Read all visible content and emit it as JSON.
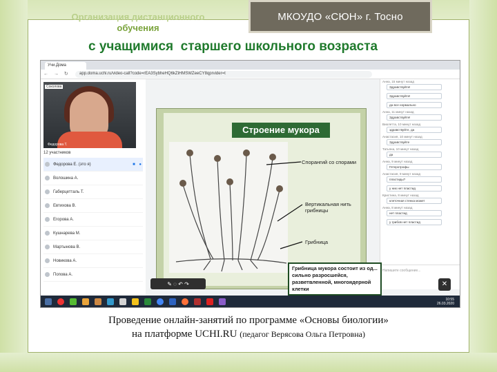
{
  "slide": {
    "org_title_line1": "Организация дистанционного",
    "org_title_line2": "обучения",
    "badge": "МКОУДО «СЮН»  г. Тосно",
    "subtitle": "с учащимися  старшего школьного возраста",
    "caption_line1": "Проведение онлайн-занятий по программе «Основы биологии»",
    "caption_line2": "на платформе UCHI.RU",
    "caption_note": "(педагог Верясова Ольга Петровна)"
  },
  "browser": {
    "tab_label": "Учи.Дома",
    "url": "app.doma.uchi.ru/video-call?code=rEA3SybheHQ6kZiHMSWZeeCY8qprvider=t",
    "nav_icons": "← → ↻"
  },
  "meeting": {
    "video_name": "Федорова Т.",
    "camera_tag": "Соколова",
    "participants_count": "12 участников",
    "participants": [
      "Федорова Е. (это я)",
      "Волошина А.",
      "Габерцетталь Т.",
      "Евтихова В.",
      "Егорова А.",
      "Кушнарева М.",
      "Мартынова В.",
      "Новикова А.",
      "Попова А."
    ]
  },
  "board": {
    "title": "Строение мукора",
    "label_sporangium": "Спорангий со спорами",
    "label_hypha_1": "Вертикальная нить",
    "label_hypha_2": "грибницы",
    "label_mycelium": "Грибница",
    "note": "Грибница мукора состоит из од... сильно разросшейся, разветвленной, многоядерной клетки"
  },
  "chat": {
    "messages": [
      {
        "meta": "Анна, 15 минут назад",
        "text": "Здравствуйте!"
      },
      {
        "meta": "",
        "text": "Здравствуйте!"
      },
      {
        "meta": "",
        "text": "да все нормально"
      },
      {
        "meta": "Анна, 11 минут назад",
        "text": "Здравствуйте!"
      },
      {
        "meta": "Виолетта, 10 минут назад",
        "text": "здравствуйте, да"
      },
      {
        "meta": "Анастасия, 10 минут назад",
        "text": "Здравствуйте"
      },
      {
        "meta": "Татьяна, 10 минут назад",
        "text": "да"
      },
      {
        "meta": "Анна, 9 минут назад",
        "text": "Гетеротрофы"
      },
      {
        "meta": "Анастасия, 9 минут назад",
        "text": "пластиды?"
      },
      {
        "meta": "",
        "text": "у них нет пластид"
      },
      {
        "meta": "Кристина, 8 минут назад",
        "text": "клеточная стенка может"
      },
      {
        "meta": "Анна, 8 минут назад",
        "text": "нет пластид"
      },
      {
        "meta": "",
        "text": "у грибов нет пластид"
      }
    ],
    "input_placeholder": "Напишите сообщение..."
  },
  "drawing_tools": "✎ ◌ ↶ ↷",
  "taskbar": {
    "time": "10:55",
    "date": "26.03.2020"
  },
  "colors": {
    "frame_green": "#cfe0a6",
    "title_green": "#1f7a2c",
    "badge_bg": "#6f6a5d",
    "board_title_bg": "#2e6a34"
  }
}
